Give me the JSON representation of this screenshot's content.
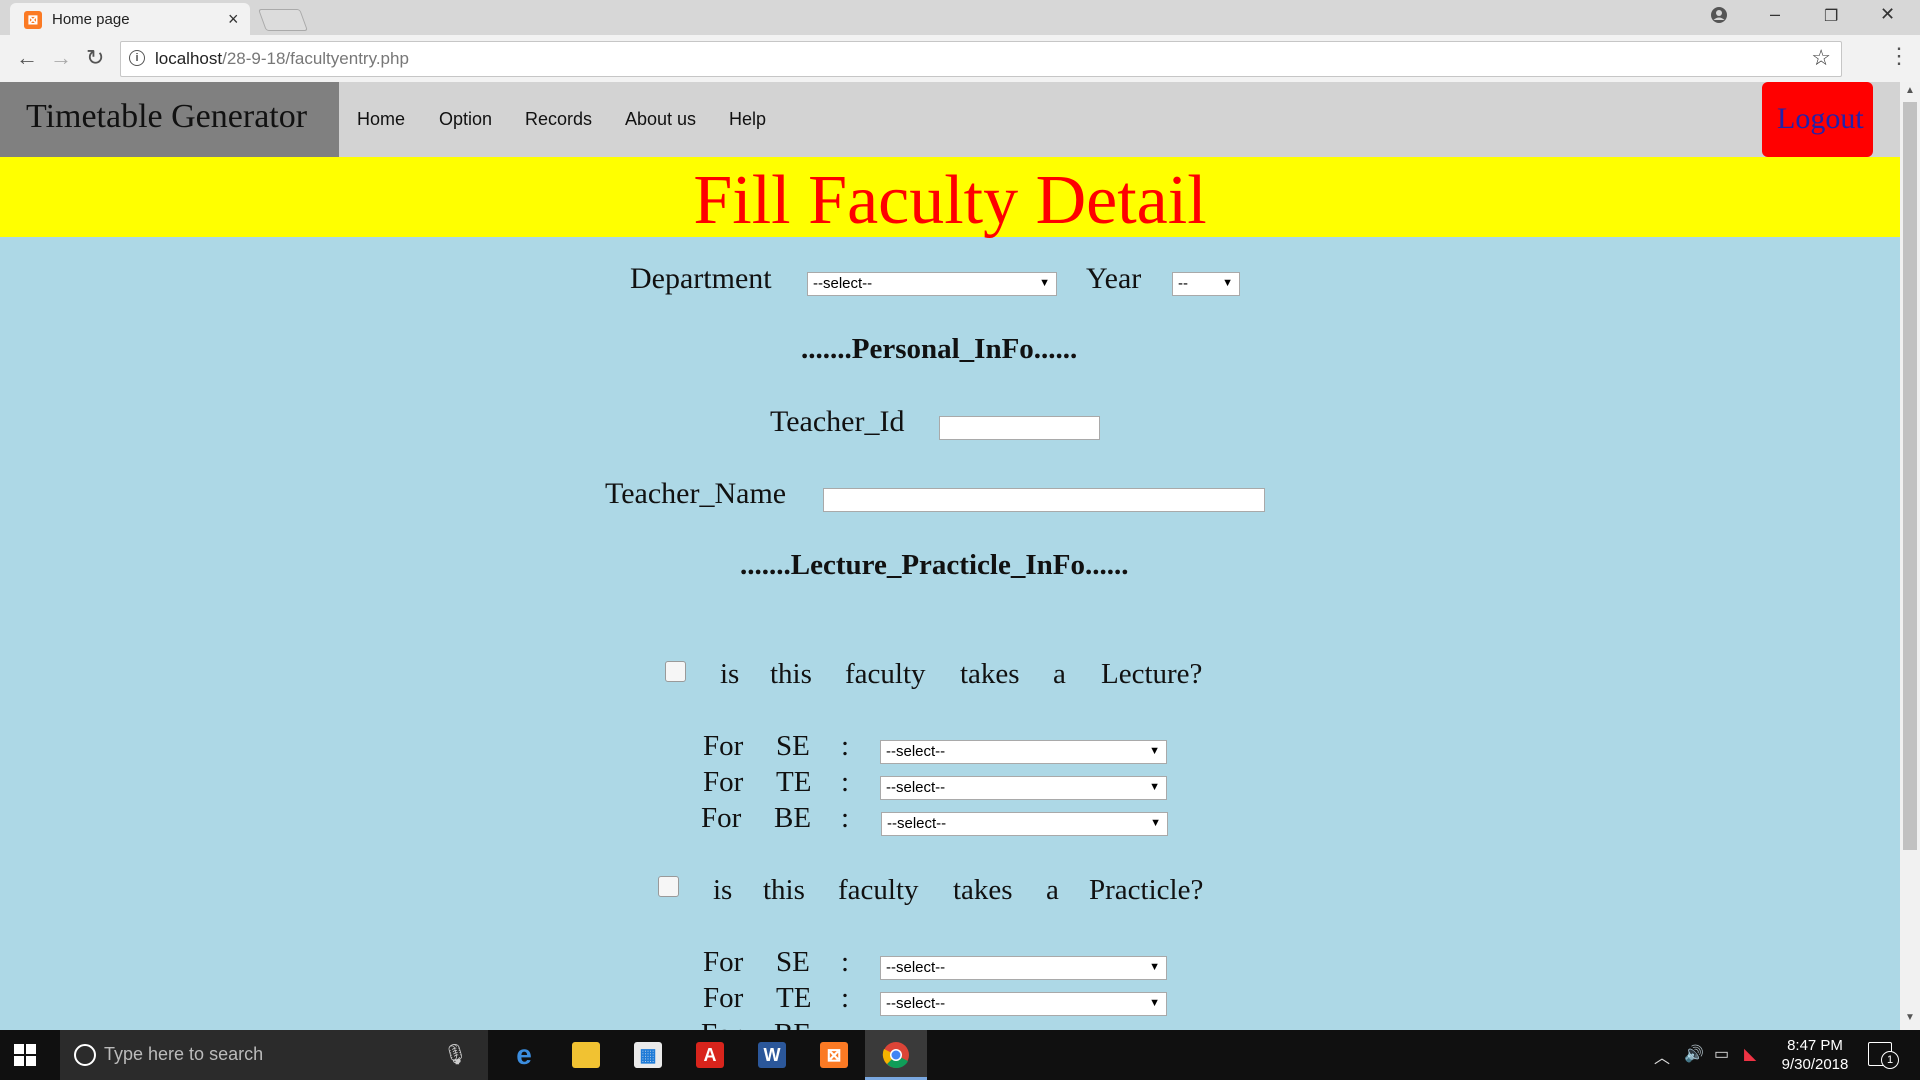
{
  "browser": {
    "tab_title": "Home page",
    "tab_close": "×",
    "url_host": "localhost",
    "url_path": "/28-9-18/facultyentry.php",
    "back": "←",
    "forward": "→",
    "reload": "↻",
    "star": "☆",
    "menu": "⋮",
    "minimize": "–",
    "maximize": "❐",
    "close": "✕"
  },
  "navbar": {
    "brand": "Timetable Generator",
    "links": [
      "Home",
      "Option",
      "Records",
      "About us",
      "Help"
    ],
    "logout": "Logout"
  },
  "banner": {
    "title": "Fill Faculty Detail"
  },
  "form": {
    "department_label": "Department",
    "department_value": "--select--",
    "year_label": "Year",
    "year_value": "--",
    "personal_header": ".......Personal_InFo......",
    "teacher_id_label": "Teacher_Id",
    "teacher_id_value": "",
    "teacher_name_label": "Teacher_Name",
    "teacher_name_value": "",
    "lecture_header": ".......Lecture_Practicle_InFo......",
    "lecture_question": [
      "is",
      "this",
      "faculty",
      "takes",
      "a",
      "Lecture?"
    ],
    "practicle_question": [
      "is",
      "this",
      "faculty",
      "takes",
      "a",
      "Practicle?"
    ],
    "lecture_checked": false,
    "practicle_checked": false,
    "for_word": "For",
    "colon": ":",
    "levels": [
      "SE",
      "TE",
      "BE"
    ],
    "select_value": "--select--"
  },
  "taskbar": {
    "search_placeholder": "Type here to search",
    "time": "8:47 PM",
    "date": "9/30/2018",
    "notification_count": "1",
    "apps": [
      "edge-icon",
      "file-explorer-icon",
      "store-icon",
      "acrobat-icon",
      "word-icon",
      "xampp-icon",
      "chrome-icon"
    ]
  },
  "colors": {
    "page_bg": "#add8e6",
    "banner_bg": "#ffff00",
    "banner_text": "#ff0000",
    "logout_bg": "#ff0000",
    "brand_bg": "#808080",
    "navbar_bg": "#d3d3d3"
  }
}
